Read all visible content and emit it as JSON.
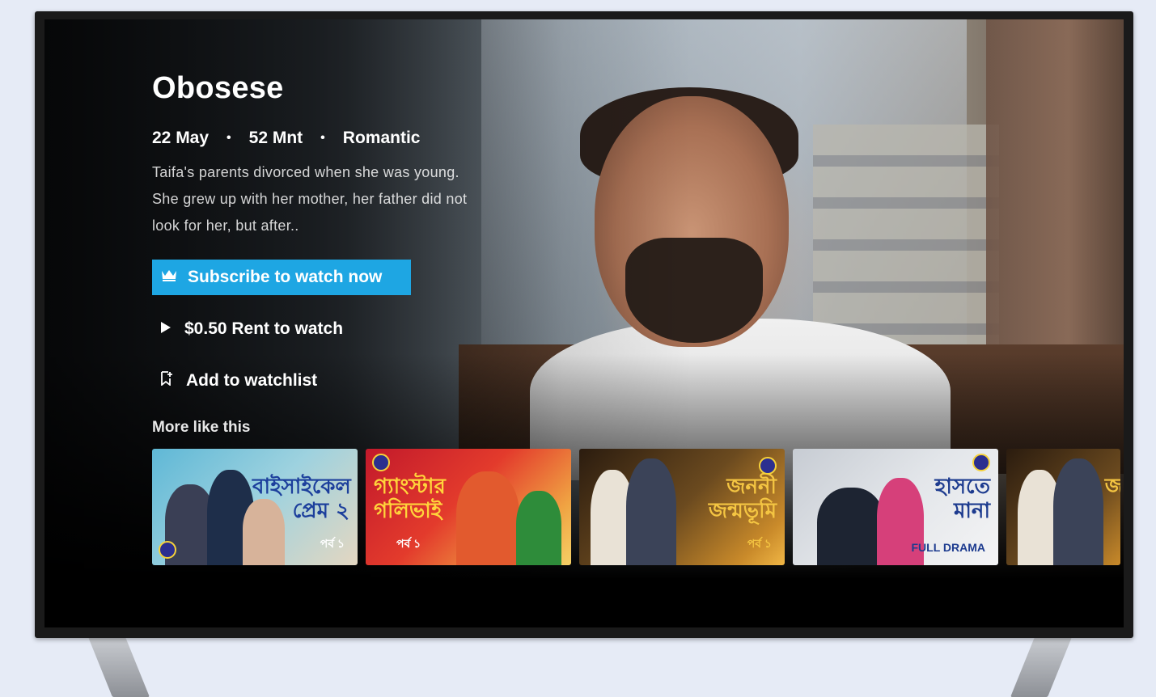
{
  "movie": {
    "title": "Obosese",
    "date": "22 May",
    "duration": "52 Mnt",
    "genre": "Romantic",
    "separator": "•",
    "description": "Taifa's parents divorced when she was young. She grew up with her mother, her father did not look for her, but after.."
  },
  "actions": {
    "subscribe_label": "Subscribe to watch now",
    "rent_label": "$0.50 Rent to watch",
    "watchlist_label": "Add to watchlist"
  },
  "more_like_this": {
    "heading": "More like this",
    "tiles": [
      {
        "title_text": "বাইসাইকেল প্রেম ২",
        "sub_text": "পর্ব ১"
      },
      {
        "title_text": "গ্যাংস্টার গলিভাই",
        "sub_text": "পর্ব ১"
      },
      {
        "title_text": "জননী জন্মভূমি",
        "sub_text": "পর্ব ১"
      },
      {
        "title_text": "হাসতে মানা",
        "sub_text": "FULL DRAMA"
      },
      {
        "title_text": "জ",
        "sub_text": ""
      }
    ]
  },
  "colors": {
    "accent": "#1ea6e3",
    "text": "#ffffff",
    "page_background": "#e6ebf6"
  },
  "icons": {
    "subscribe": "crown-icon",
    "rent": "play-icon",
    "watchlist": "bookmark-add-icon"
  }
}
